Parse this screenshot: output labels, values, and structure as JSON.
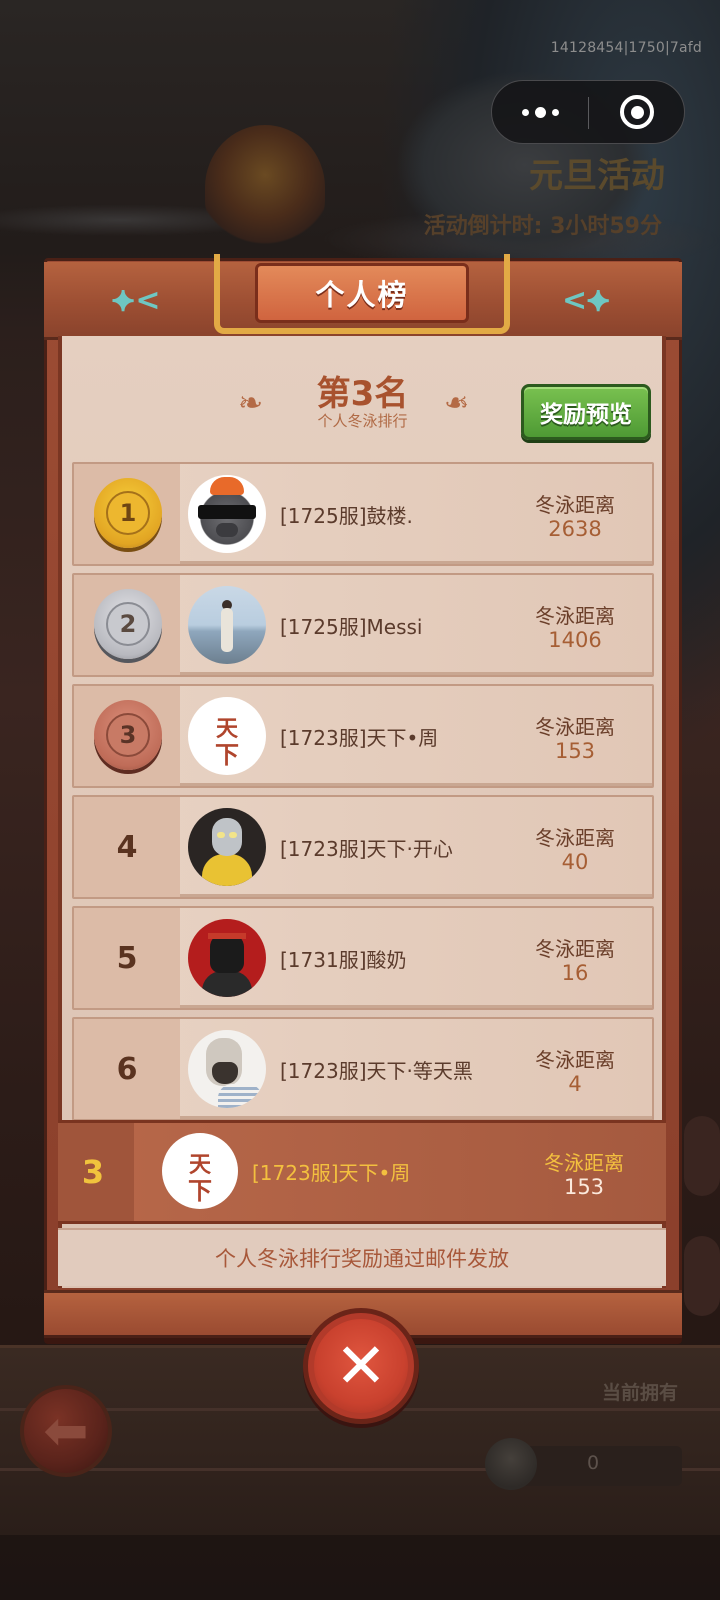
{
  "overlay": {
    "debug_id": "14128454|1750|7afd",
    "event_title": "元旦活动",
    "countdown": "活动倒计时: 3小时59分",
    "have_label": "当前拥有",
    "have_value": "0"
  },
  "modal": {
    "title": "个人榜",
    "my_rank_title": "第3名",
    "my_rank_subtitle": "个人冬泳排行",
    "reward_button": "奖励预览",
    "footer_note": "个人冬泳排行奖励通过邮件发放",
    "colors": {
      "accent": "#a8522e",
      "reward_green": "#5aa83c",
      "highlight_gold": "#f3c03f"
    }
  },
  "leaderboard": [
    {
      "rank": "1",
      "medal": "gold",
      "avatar": "avatar-rat-sunglasses",
      "name": "[1725服]鼓楼.",
      "dist_label": "冬泳距离",
      "dist": "2638"
    },
    {
      "rank": "2",
      "medal": "silver",
      "avatar": "avatar-seaside-photo",
      "name": "[1725服]Messi",
      "dist_label": "冬泳距离",
      "dist": "1406"
    },
    {
      "rank": "3",
      "medal": "bronze",
      "avatar": "avatar-tianxia-seal",
      "name": "[1723服]天下•周",
      "dist_label": "冬泳距离",
      "dist": "153"
    },
    {
      "rank": "4",
      "medal": "",
      "avatar": "avatar-ultraman",
      "name": "[1723服]天下·开心",
      "dist_label": "冬泳距离",
      "dist": "40"
    },
    {
      "rank": "5",
      "medal": "",
      "avatar": "avatar-ape-red",
      "name": "[1731服]酸奶",
      "dist_label": "冬泳距离",
      "dist": "16"
    },
    {
      "rank": "6",
      "medal": "",
      "avatar": "avatar-sketch-man",
      "name": "[1723服]天下·等天黑",
      "dist_label": "冬泳距离",
      "dist": "4"
    }
  ],
  "me": {
    "rank": "3",
    "avatar": "avatar-tianxia-seal",
    "name": "[1723服]天下•周",
    "dist_label": "冬泳距离",
    "dist": "153"
  },
  "seal_chars": {
    "top": "天",
    "bottom": "下"
  }
}
